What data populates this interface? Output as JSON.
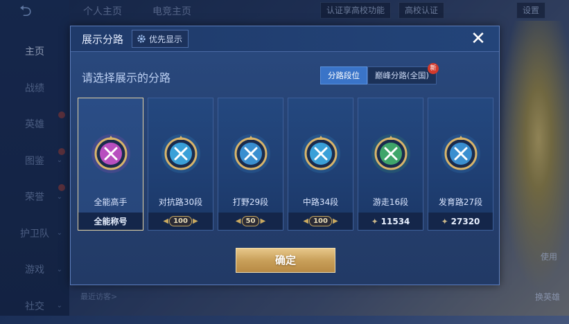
{
  "background": {
    "top_tabs": [
      "个人主页",
      "电竞主页"
    ],
    "top_buttons": [
      "认证享高校功能",
      "高校认证",
      "设置"
    ],
    "side_nav": [
      {
        "label": "主页",
        "active": true
      },
      {
        "label": "战绩"
      },
      {
        "label": "英雄"
      },
      {
        "label": "图鉴"
      },
      {
        "label": "荣誉"
      },
      {
        "label": "护卫队"
      },
      {
        "label": "游戏"
      },
      {
        "label": "社交"
      }
    ],
    "recent_visitors": "最近访客>",
    "right_labels": [
      "使用",
      "换英雄"
    ]
  },
  "modal": {
    "title": "展示分路",
    "priority_label": "优先显示",
    "close_icon": "close-icon",
    "subtitle": "请选择展示的分路",
    "toggle": {
      "rank_label": "分路段位",
      "peak_label": "巅峰分路(全国)",
      "new_badge": "新"
    },
    "cards": [
      {
        "label": "全能高手",
        "foot": "全能称号",
        "foot_type": "title",
        "color": "#b84fbf",
        "icon": "allround-emblem-icon"
      },
      {
        "label": "对抗路30段",
        "foot": "100",
        "foot_type": "badge",
        "color": "#3aa0d8",
        "icon": "clash-lane-emblem-icon"
      },
      {
        "label": "打野29段",
        "foot": "50",
        "foot_type": "badge",
        "color": "#3a8fd0",
        "icon": "jungle-emblem-icon"
      },
      {
        "label": "中路34段",
        "foot": "100",
        "foot_type": "badge",
        "color": "#3aa0d8",
        "icon": "mid-lane-emblem-icon"
      },
      {
        "label": "游走16段",
        "foot": "11534",
        "foot_type": "score",
        "color": "#3fa56a",
        "icon": "roam-emblem-icon"
      },
      {
        "label": "发育路27段",
        "foot": "27320",
        "foot_type": "score",
        "color": "#3a8fd0",
        "icon": "farm-lane-emblem-icon"
      }
    ],
    "confirm_label": "确定"
  }
}
